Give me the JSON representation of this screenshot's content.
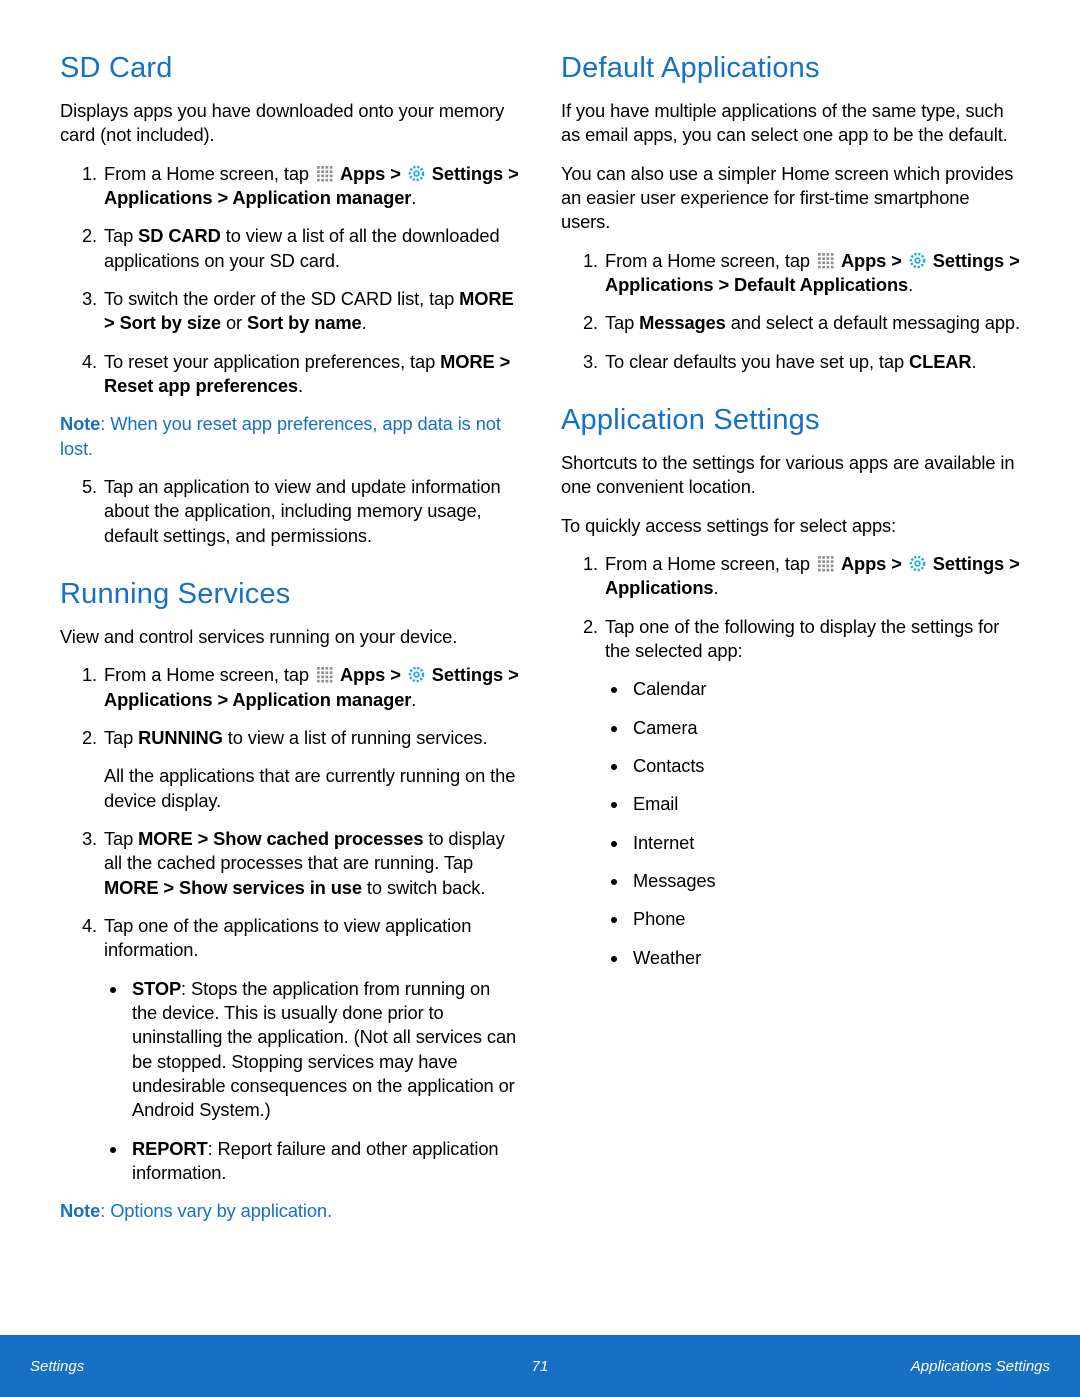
{
  "sdcard": {
    "heading": "SD Card",
    "intro": "Displays apps you have downloaded onto your memory card (not included).",
    "step1_pre": "From a Home screen, tap ",
    "apps_label": "Apps",
    "step1_mid": " > ",
    "settings_label": "Settings",
    "step1_sep": " > ",
    "applications_label": "Applications",
    "step1_sep2": " > ",
    "appmgr_label": "Application manager",
    "step1_end": ".",
    "step2_a": "Tap ",
    "step2_b": "SD CARD",
    "step2_c": " to view a list of all the downloaded applications on your SD card.",
    "step3_a": "To switch the order of the SD CARD list, tap ",
    "step3_b": "MORE",
    "step3_c": " > ",
    "step3_d": "Sort by size",
    "step3_e": " or ",
    "step3_f": "Sort by name",
    "step3_g": ".",
    "step4_a": "To reset your application preferences, tap ",
    "step4_b": "MORE",
    "step4_c": " > ",
    "step4_d": "Reset app preferences",
    "step4_e": ".",
    "note_label": "Note",
    "note_text": ": When you reset app preferences, app data is not lost.",
    "step5": "Tap an application to view and update information about the application, including memory usage, default settings, and permissions."
  },
  "running": {
    "heading": "Running Services",
    "intro": "View and control services running on your device.",
    "step1_pre": "From a Home screen, tap ",
    "step2_a": "Tap ",
    "step2_b": "RUNNING",
    "step2_c": " to view a list of running services.",
    "step2_p2": "All the applications that are currently running on the device display.",
    "step3_a": "Tap ",
    "step3_b": "MORE",
    "step3_c": " > ",
    "step3_d": "Show cached processes",
    "step3_e": " to display all the cached processes that are running. Tap ",
    "step3_f": "MORE",
    "step3_g": " > ",
    "step3_h": "Show services in use",
    "step3_i": " to switch back.",
    "step4": "Tap one of the applications to view application information.",
    "b1_a": "STOP",
    "b1_b": ": Stops the application from running on the device. This is usually done prior to uninstalling the application. (Not all services can be stopped. Stopping services may have undesirable consequences on the application or Android System.)",
    "b2_a": "REPORT",
    "b2_b": ": Report failure and other application information.",
    "note_label": "Note",
    "note_text": ": Options vary by application."
  },
  "defaults": {
    "heading": "Default Applications",
    "p1": "If you have multiple applications of the same type, such as email apps, you can select one app to be the default.",
    "p2": "You can also use a simpler Home screen which provides an easier user experience for first-time smartphone users.",
    "step1_pre": "From a Home screen, tap ",
    "defapps_label": "Default Applications",
    "step2_a": "Tap ",
    "step2_b": "Messages",
    "step2_c": " and select a default messaging app.",
    "step3_a": "To clear defaults you have set up, tap ",
    "step3_b": "CLEAR",
    "step3_c": "."
  },
  "appsettings": {
    "heading": "Application Settings",
    "p1": "Shortcuts to the settings for various apps are available in one convenient location.",
    "p2": "To quickly access settings for select apps:",
    "step1_pre": "From a Home screen, tap ",
    "step2": "Tap one of the following to display the settings for the selected app:",
    "apps": [
      "Calendar",
      "Camera",
      "Contacts",
      "Email",
      "Internet",
      "Messages",
      "Phone",
      "Weather"
    ]
  },
  "footer": {
    "left": "Settings",
    "center": "71",
    "right": "Applications Settings"
  }
}
